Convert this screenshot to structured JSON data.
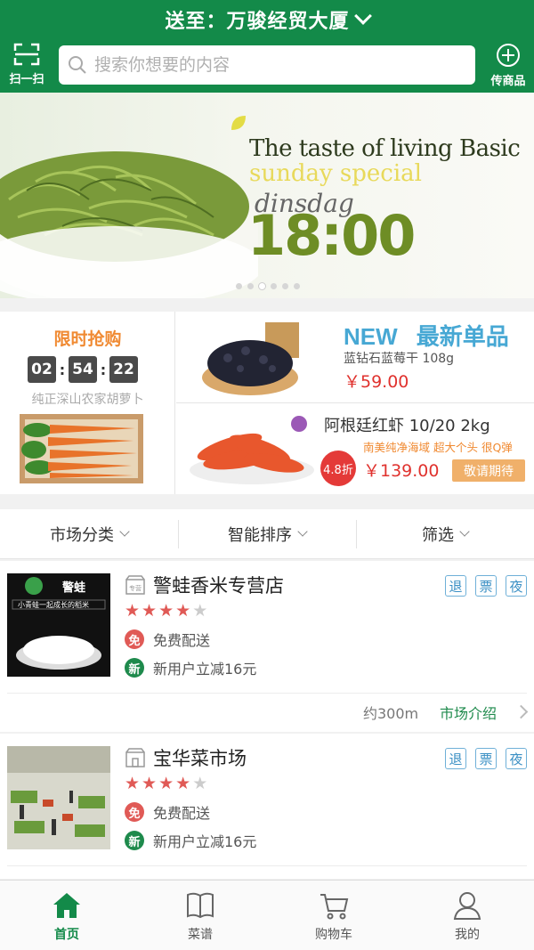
{
  "header": {
    "location_prefix": "送至：",
    "location": "万骏经贸大厦",
    "scan_label": "扫一扫",
    "search_placeholder": "搜索你想要的内容",
    "publish_label": "传商品"
  },
  "banner": {
    "line1": "The taste of living Basic",
    "line2": "sunday special",
    "line3": "dinsdag",
    "time": "18:00",
    "page_count": 6,
    "active_page": 2
  },
  "flash_sale": {
    "title": "限时抢购",
    "hours": "02",
    "minutes": "54",
    "seconds": "22",
    "product": "纯正深山农家胡萝卜"
  },
  "new_item": {
    "tag_en": "NEW",
    "tag_cn": "最新单品",
    "name": "蓝钻石蓝莓干 108g",
    "price": "￥59.00"
  },
  "promo_item": {
    "name": "阿根廷红虾 10/20 2kg",
    "desc": "南美纯净海域 超大个头 很Q弹",
    "discount": "4.8折",
    "price": "￥139.00",
    "status": "敬请期待"
  },
  "filters": [
    "市场分类",
    "智能排序",
    "筛选"
  ],
  "shops": [
    {
      "name": "警蛙香米专营店",
      "store_icon_text": "专营",
      "logo_text": "警蛙",
      "slogan": "小青蛙一起成长的稻米",
      "rating": 4,
      "free_delivery_badge": "免",
      "free_delivery": "免费配送",
      "new_user_badge": "新",
      "new_user": "新用户立减16元",
      "tags": [
        "退",
        "票",
        "夜"
      ],
      "distance": "约300m",
      "intro_link": "市场介绍"
    },
    {
      "name": "宝华菜市场",
      "rating": 4,
      "free_delivery_badge": "免",
      "free_delivery": "免费配送",
      "new_user_badge": "新",
      "new_user": "新用户立减16元",
      "tags": [
        "退",
        "票",
        "夜"
      ]
    }
  ],
  "tabbar": [
    {
      "label": "首页",
      "icon": "home-icon",
      "active": true
    },
    {
      "label": "菜谱",
      "icon": "book-icon",
      "active": false
    },
    {
      "label": "购物车",
      "icon": "cart-icon",
      "active": false
    },
    {
      "label": "我的",
      "icon": "user-icon",
      "active": false
    }
  ],
  "colors": {
    "brand_green": "#138a49",
    "price_red": "#e0322e",
    "accent_orange": "#f08a32",
    "tag_blue": "#47a8d4"
  }
}
